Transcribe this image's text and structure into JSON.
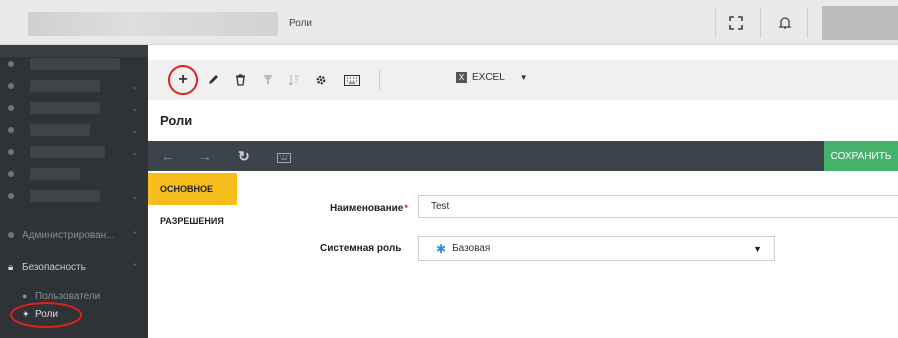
{
  "header": {
    "title": "Роли",
    "fullscreen_icon": "fullscreen-icon",
    "bell_icon": "bell-icon"
  },
  "sidebar": {
    "section_admin": "Администрирован...",
    "section_security": "Безопасность",
    "users_label": "Пользователи",
    "roles_label": "Роли"
  },
  "toolbar": {
    "icons": [
      "plus-icon",
      "pencil-icon",
      "trash-icon",
      "filter-clear-icon",
      "sort-icon",
      "gear-icon",
      "keyboard-icon",
      "excel-icon",
      "caret-down-icon"
    ],
    "excel_label": "EXCEL"
  },
  "page": {
    "title": "Роли"
  },
  "navbar": {
    "save_label": "СОХРАНИТЬ"
  },
  "tabs": {
    "main": "ОСНОВНОЕ",
    "permissions": "РАЗРЕШЕНИЯ"
  },
  "form": {
    "name_label": "Наименование",
    "name_required": "*",
    "name_value": "Test",
    "system_role_label": "Системная роль",
    "system_role_value": "Базовая"
  },
  "colors": {
    "accent_tab": "#f7bf1c",
    "save_green": "#45b26b",
    "annotation_red": "#e0201b",
    "sidebar_bg": "#2f3237",
    "navbar_bg": "#3d434b"
  }
}
